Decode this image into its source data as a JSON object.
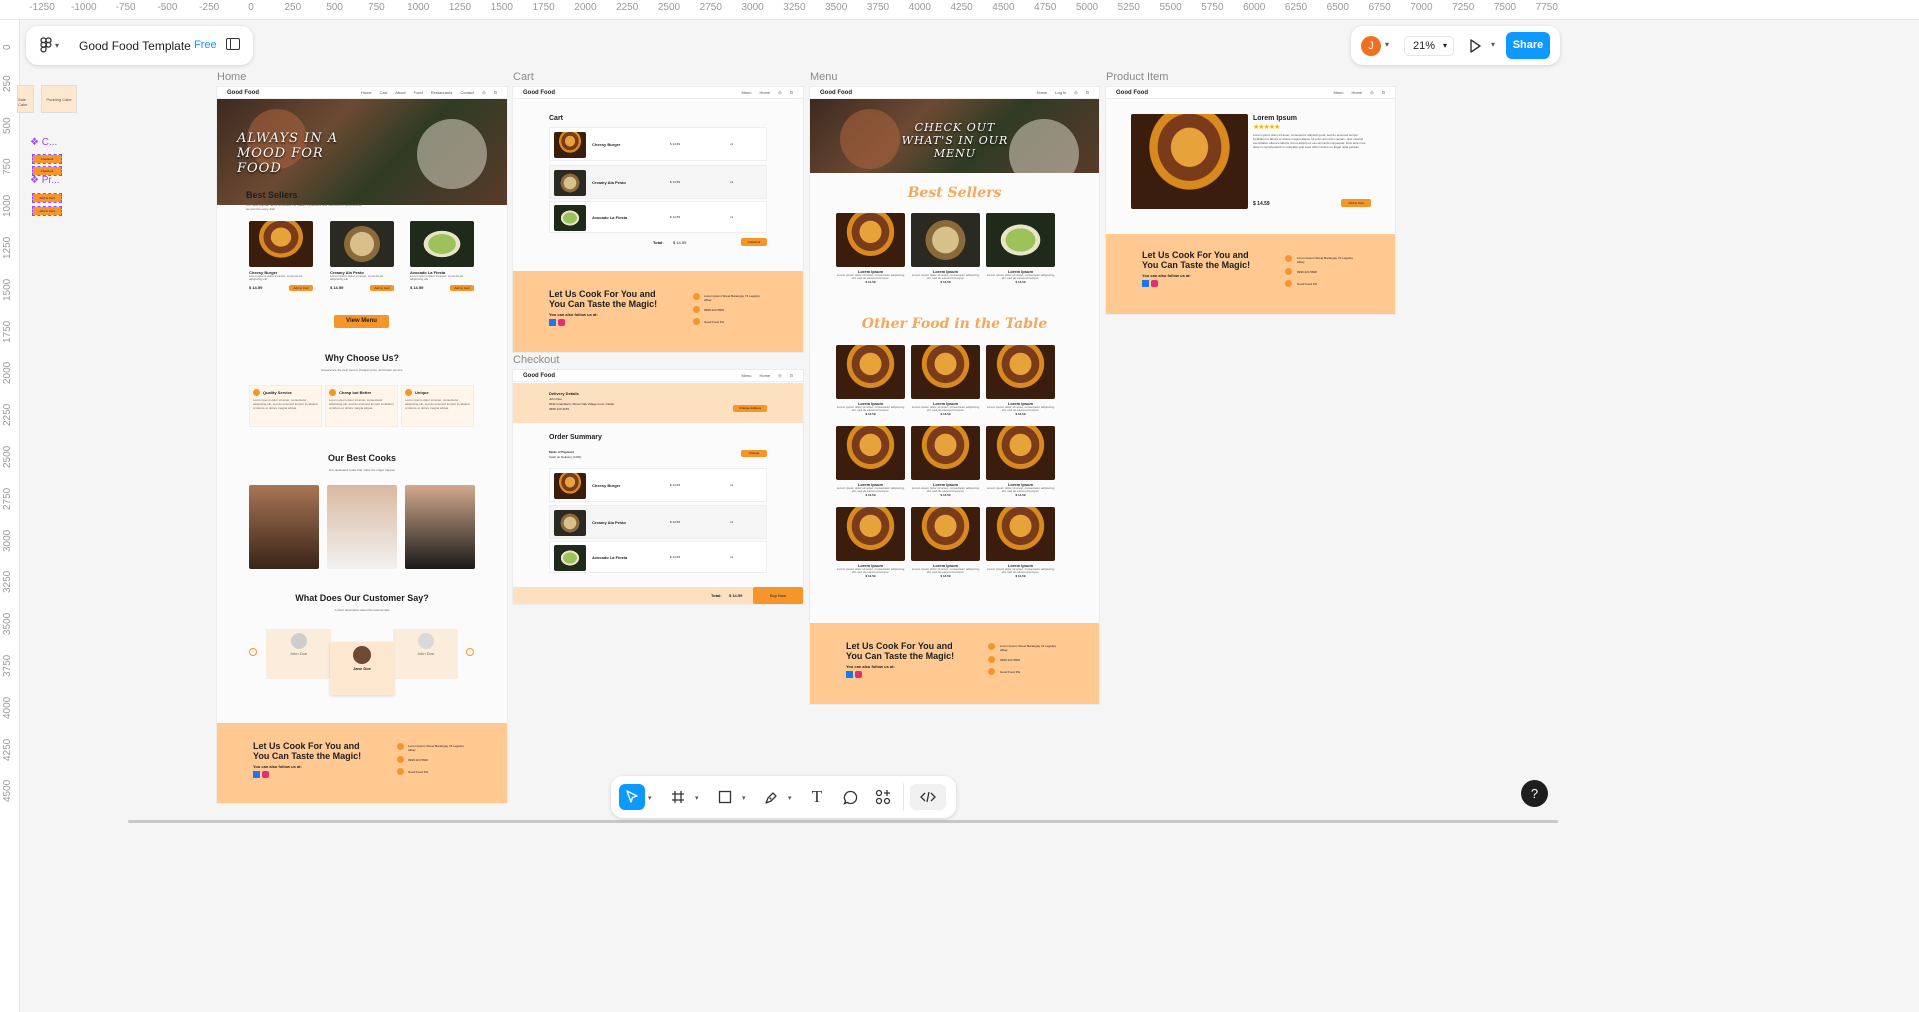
{
  "file": {
    "title": "Good Food Template",
    "plan_badge": "Free"
  },
  "user": {
    "avatar_initial": "J",
    "zoom": "21%",
    "share_label": "Share"
  },
  "ruler": {
    "top": [
      "-1250",
      "-1000",
      "-750",
      "-500",
      "-250",
      "0",
      "250",
      "500",
      "750",
      "1000",
      "1250",
      "1500",
      "1750",
      "2000",
      "2250",
      "2500",
      "2750",
      "3000",
      "3250",
      "3500",
      "3750",
      "4000",
      "4250",
      "4500",
      "4750",
      "5000",
      "5250",
      "5500",
      "5750",
      "6000",
      "6250",
      "6500",
      "6750",
      "7000",
      "7250",
      "7500",
      "7750"
    ],
    "left": [
      "0",
      "250",
      "500",
      "750",
      "1000",
      "1250",
      "1500",
      "1750",
      "2000",
      "2250",
      "2500",
      "2750",
      "3000",
      "3250",
      "3500",
      "3750",
      "4000",
      "4250",
      "4500"
    ]
  },
  "components": {
    "c1": "C...",
    "c2": "Pr...",
    "left_frame_1": "Sale Cake",
    "left_frame_2": "Pudding Cake",
    "checkout_1": "Checkout",
    "checkout_2": "Checkout",
    "btn_1": "Add to Cart",
    "btn_2": "Add to Cart"
  },
  "frames": {
    "home": "Home",
    "cart": "Cart",
    "menu": "Menu",
    "product": "Product Item",
    "checkout": "Checkout"
  },
  "brand": "Good Food",
  "home": {
    "nav": [
      "Home",
      "Cart",
      "About",
      "Food",
      "Restaurants",
      "Contact"
    ],
    "hero": "ALWAYS IN A MOOD FOR FOOD",
    "best_title": "Best Sellers",
    "best_desc": "Our most popular items showcase the quality ingredients and meticulous craftsmanship we put into every dish",
    "items": [
      {
        "name": "Cheesy Burger",
        "price": "$ 14.59",
        "btn": "Add to Cart"
      },
      {
        "name": "Creamy Ala Pesto",
        "price": "$ 14.59",
        "btn": "Add to Cart"
      },
      {
        "name": "Avocado La Fiesta",
        "price": "$ 14.59",
        "btn": "Add to Cart"
      }
    ],
    "item_desc": "Lorem ipsum dolor sit amet, consectetur adipiscing elit",
    "view_menu": "View Menu",
    "why_title": "Why Choose Us?",
    "why_desc": "Experience the best food in cheaper price, and better service",
    "why": [
      {
        "title": "Quality Service"
      },
      {
        "title": "Cheap but Better"
      },
      {
        "title": "Unique"
      }
    ],
    "why_text": "Lorem ipsum dolor sit amet, consectetur adipiscing elit, sed do eiusmod tempor incididunt ut labore et dolore magna aliqua.",
    "cooks_title": "Our Best Cooks",
    "cooks_desc": "Our dedicated cooks that make the magic happen",
    "testi_title": "What Does Our Customer Say?",
    "testi_desc": "A short description about the testimonials",
    "testimonials": [
      {
        "name": "John Doe"
      },
      {
        "name": "Jane Doe"
      },
      {
        "name": "John Doe"
      }
    ]
  },
  "footer": {
    "title": "Let Us Cook For You and You Can Taste the Magic!",
    "follow": "You can also follow us at:",
    "address": "Lorem Ipsum Street Barangay 74 Legazpi, Albay",
    "phone": "0999 224 5600",
    "fb": "Good Food PH"
  },
  "cart": {
    "title": "Cart",
    "nav": [
      "Menu",
      "Home"
    ],
    "items": [
      {
        "name": "Cheesy Burger",
        "price": "$ 14.59",
        "qty": "x1"
      },
      {
        "name": "Creamy Ala Pesto",
        "price": "$ 14.59",
        "qty": "x1"
      },
      {
        "name": "Avocado La Fiesta",
        "price": "$ 14.59",
        "qty": "x1"
      }
    ],
    "total_label": "Total:",
    "total": "$ 14.59",
    "checkout_btn": "Checkout"
  },
  "checkout": {
    "nav": [
      "Menu",
      "Home"
    ],
    "delivery_title": "Delivery Details",
    "delivery_name": "John Doe",
    "delivery_addr": "#042 Grandberry Street Oak Village Imus, Cavite",
    "delivery_phone": "0969 123 4165",
    "change_addr": "Change Address",
    "summary_title": "Order Summary",
    "payment_label": "Mode of Payment",
    "payment_value": "Cash on Delivery (COD)",
    "change": "Change",
    "total_label": "Total:",
    "total": "$ 14.59",
    "buy_now": "Buy Now"
  },
  "menu": {
    "nav": [
      "Home",
      "Log in"
    ],
    "hero": "CHECK OUT WHAT'S IN OUR MENU",
    "best_title": "Best Sellers",
    "other_title": "Other Food in the Table",
    "item_name": "Lorem Ipsum",
    "item_desc": "Lorem ipsum dolor sit amet, consectetur adipiscing elit, sed do eiusmod tempor.",
    "price": "$ 14.59"
  },
  "product": {
    "nav": [
      "Menu",
      "Home"
    ],
    "name": "Lorem Ipsum",
    "stars": "★★★★★",
    "desc": "Lorem ipsum dolor sit amet, consectetur adipiscing elit, sed do eiusmod tempor incididunt ut labore et dolore magna aliqua. Ut enim ad minim veniam, quis nostrud exercitation ullamco laboris nisi ut aliquip ex ea commodo consequat. Duis aute irure dolor in reprehenderit in voluptate velit esse cillum dolore eu fugiat nulla pariatur.",
    "price": "$ 14.59",
    "btn": "Add to Cart"
  },
  "help": "?",
  "colors": {
    "accent": "#f6962a",
    "peach": "#ffc991",
    "share": "#0d99ff",
    "component": "#9747ff"
  }
}
